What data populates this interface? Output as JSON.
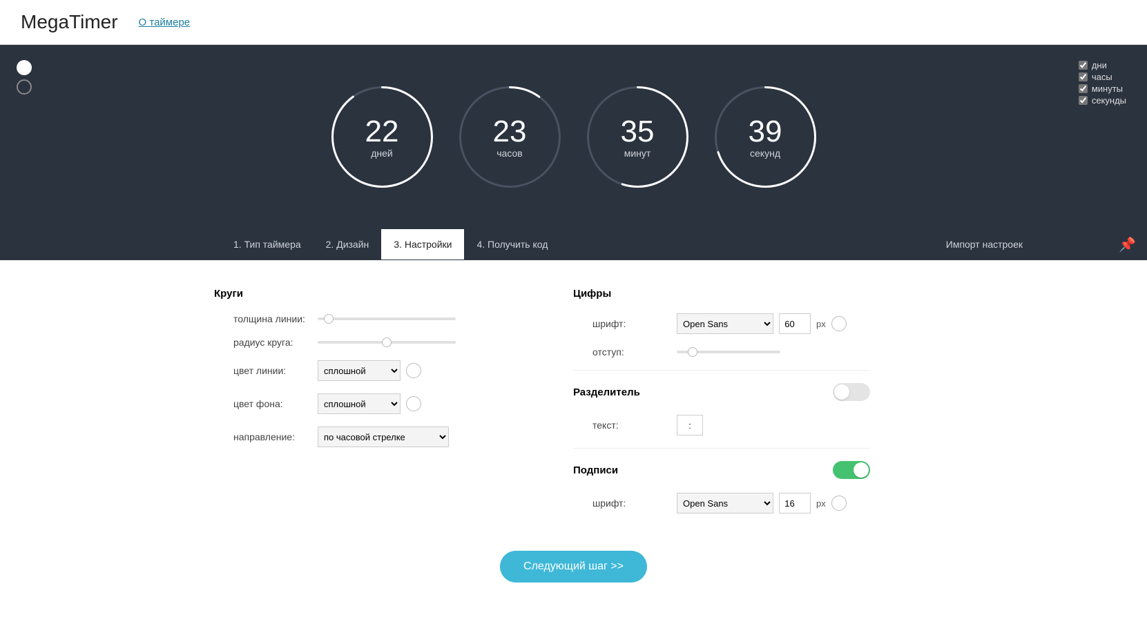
{
  "header": {
    "logo": "MegaTimer",
    "about": "О таймере"
  },
  "legend": {
    "days": "дни",
    "hours": "часы",
    "minutes": "минуты",
    "seconds": "секунды",
    "days_on": true,
    "hours_on": true,
    "minutes_on": true,
    "seconds_on": true
  },
  "timer": {
    "units": [
      {
        "value": "22",
        "label": "дней",
        "fraction": 0.9
      },
      {
        "value": "23",
        "label": "часов",
        "fraction": 0.1
      },
      {
        "value": "35",
        "label": "минут",
        "fraction": 0.55
      },
      {
        "value": "39",
        "label": "секунд",
        "fraction": 0.7
      }
    ]
  },
  "tabs": {
    "items": [
      "1. Тип таймера",
      "2. Дизайн",
      "3. Настройки",
      "4. Получить код"
    ],
    "active": 2,
    "import": "Импорт настроек"
  },
  "left": {
    "title": "Круги",
    "thickness_label": "толщина линии:",
    "radius_label": "радиус круга:",
    "line_color_label": "цвет линии:",
    "bg_color_label": "цвет фона:",
    "direction_label": "направление:",
    "solid_option": "сплошной",
    "direction_option": "по часовой стрелке",
    "thickness": 5,
    "radius": 50
  },
  "right": {
    "digits_title": "Цифры",
    "font_label": "шрифт:",
    "font_value": "Open Sans",
    "size_value": "60",
    "px": "px",
    "offset_label": "отступ:",
    "offset": 12,
    "sep_title": "Разделитель",
    "sep_text_label": "текст:",
    "sep_text_value": ":",
    "sep_on": false,
    "labels_title": "Подписи",
    "labels_on": true,
    "labels_font": "Open Sans",
    "labels_size": "16"
  },
  "next": "Следующий шаг >>"
}
